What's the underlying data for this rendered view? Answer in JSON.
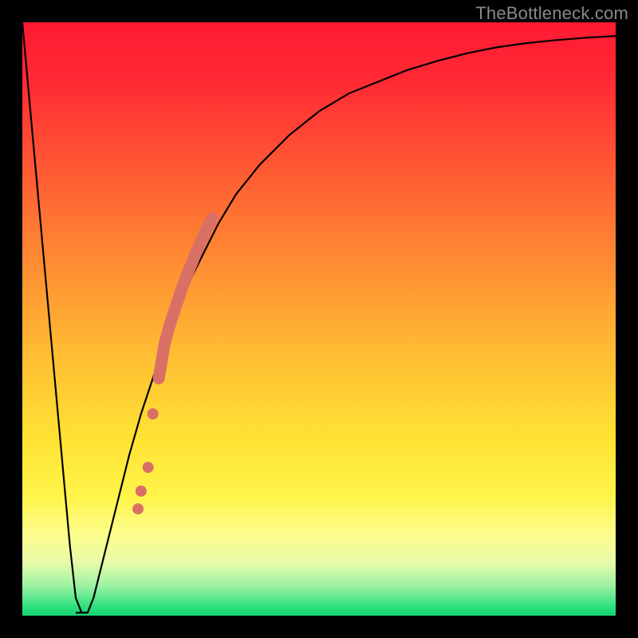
{
  "watermark": "TheBottleneck.com",
  "gradient_stops": [
    {
      "offset": 0.0,
      "color": "#ff1a33"
    },
    {
      "offset": 0.1,
      "color": "#ff2a33"
    },
    {
      "offset": 0.25,
      "color": "#ff5a33"
    },
    {
      "offset": 0.4,
      "color": "#ff8a33"
    },
    {
      "offset": 0.55,
      "color": "#ffba33"
    },
    {
      "offset": 0.7,
      "color": "#ffe233"
    },
    {
      "offset": 0.8,
      "color": "#fff44a"
    },
    {
      "offset": 0.86,
      "color": "#fdfd8a"
    },
    {
      "offset": 0.91,
      "color": "#e8fba8"
    },
    {
      "offset": 0.95,
      "color": "#9cf2a4"
    },
    {
      "offset": 0.985,
      "color": "#2de07e"
    },
    {
      "offset": 1.0,
      "color": "#16d173"
    }
  ],
  "marker_color": "#d97066",
  "chart_data": {
    "type": "line",
    "title": "",
    "xlabel": "",
    "ylabel": "",
    "xlim": [
      0,
      100
    ],
    "ylim": [
      0,
      100
    ],
    "series": [
      {
        "name": "bottleneck-curve",
        "x": [
          0,
          2,
          4,
          6,
          8,
          9,
          10,
          11,
          12,
          14,
          16,
          18,
          20,
          22,
          24,
          26,
          28,
          30,
          33,
          36,
          40,
          45,
          50,
          55,
          60,
          65,
          70,
          75,
          80,
          85,
          90,
          95,
          100
        ],
        "y": [
          100,
          78,
          56,
          34,
          12,
          3,
          0.5,
          0.5,
          3,
          11,
          19,
          27,
          34,
          40,
          46,
          51,
          56,
          60,
          66,
          71,
          76,
          81,
          85,
          88,
          90,
          92,
          93.5,
          94.8,
          95.8,
          96.5,
          97,
          97.4,
          97.7
        ]
      }
    ],
    "markers": {
      "name": "dense-marker-segment",
      "x": [
        19.5,
        20.0,
        21.2,
        22.0,
        23.0,
        24.0,
        25.0,
        26.0,
        27.0,
        28.0,
        29.0,
        30.0,
        31.0,
        32.0
      ],
      "y": [
        18.0,
        21.0,
        25.0,
        34.0,
        40.0,
        46.0,
        49.5,
        52.5,
        55.5,
        58.0,
        60.5,
        62.8,
        65.0,
        67.0
      ]
    },
    "optimal_flat": {
      "x_start": 9,
      "x_end": 11,
      "y": 0.5
    }
  }
}
